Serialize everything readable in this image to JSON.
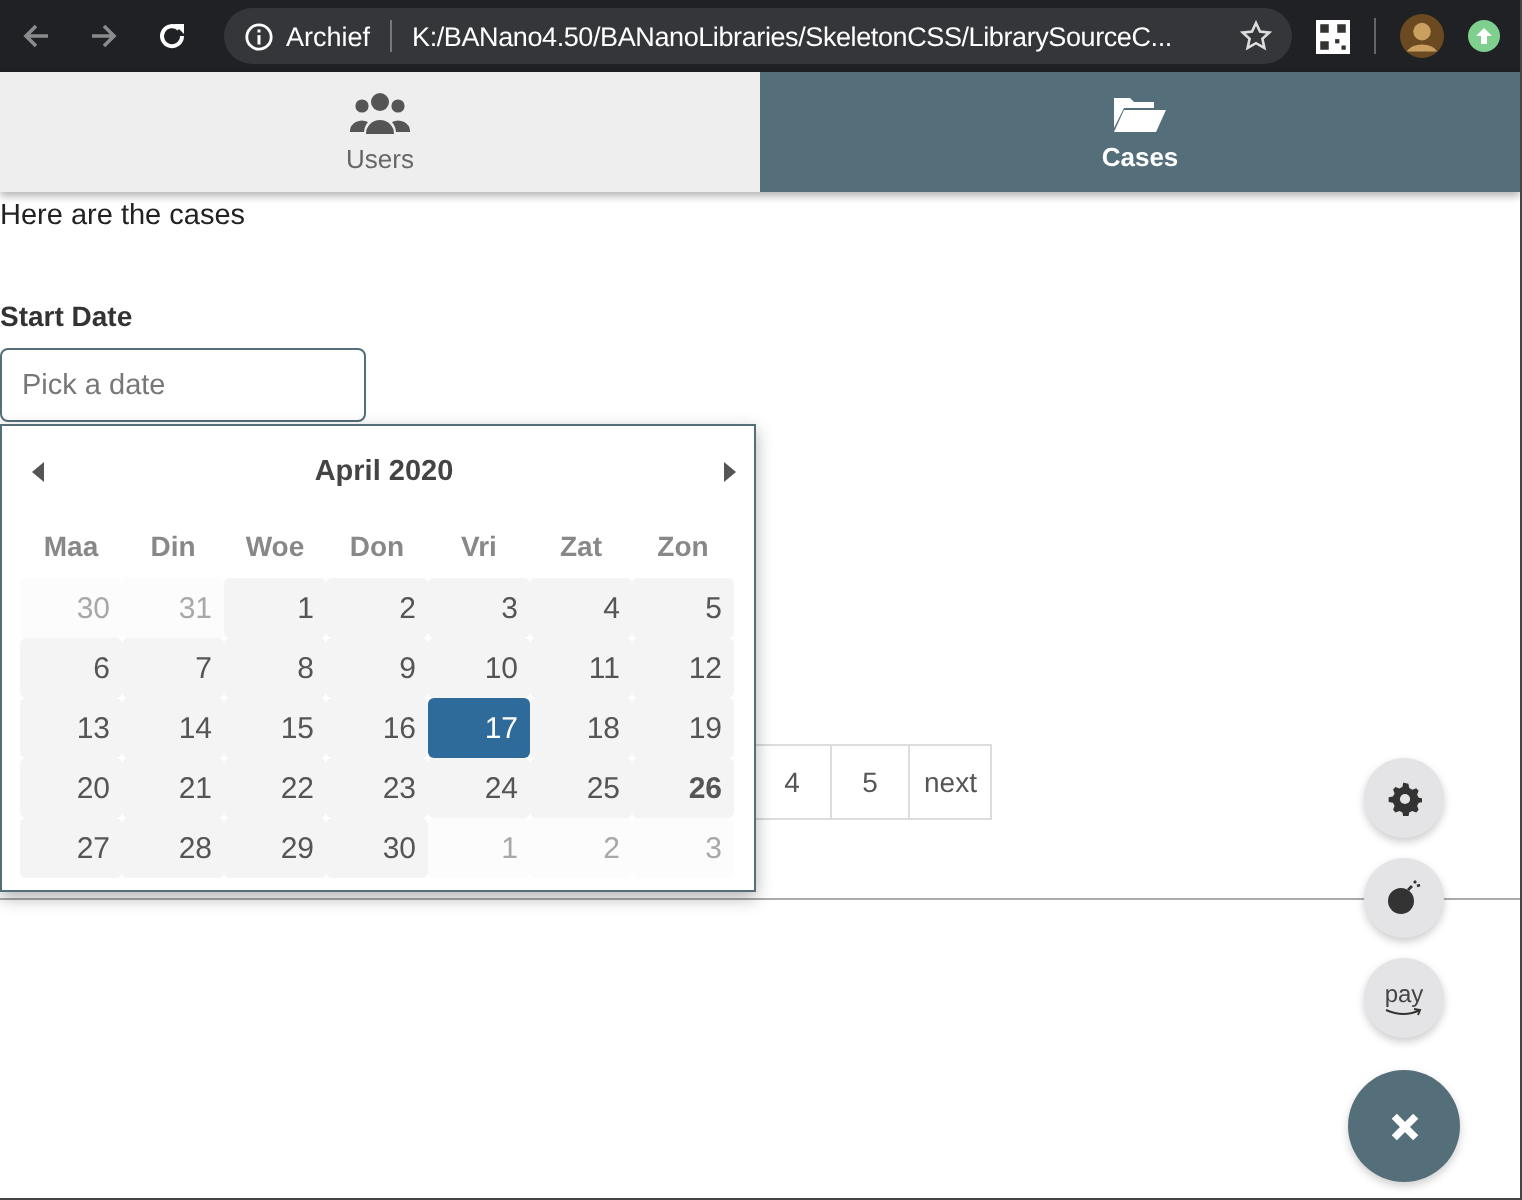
{
  "browser": {
    "site_label": "Archief",
    "url": "K:/BANano4.50/BANanoLibraries/SkeletonCSS/LibrarySourceC..."
  },
  "tabs": [
    {
      "label": "Users",
      "kind": "users",
      "selected": false
    },
    {
      "label": "Cases",
      "kind": "cases",
      "selected": true
    }
  ],
  "intro": "Here are the cases",
  "start_date": {
    "label": "Start Date",
    "placeholder": "Pick a date"
  },
  "calendar": {
    "month": "April",
    "year": "2020",
    "weekdays": [
      "Maa",
      "Din",
      "Woe",
      "Don",
      "Vri",
      "Zat",
      "Zon"
    ],
    "weeks": [
      [
        {
          "day": "30",
          "kind": "outside",
          "selected": false
        },
        {
          "day": "31",
          "kind": "outside",
          "selected": false
        },
        {
          "day": "1",
          "kind": "day",
          "selected": false
        },
        {
          "day": "2",
          "kind": "day",
          "selected": false
        },
        {
          "day": "3",
          "kind": "day",
          "selected": false
        },
        {
          "day": "4",
          "kind": "day",
          "selected": false
        },
        {
          "day": "5",
          "kind": "day",
          "selected": false
        }
      ],
      [
        {
          "day": "6",
          "kind": "day",
          "selected": false
        },
        {
          "day": "7",
          "kind": "day",
          "selected": false
        },
        {
          "day": "8",
          "kind": "day",
          "selected": false
        },
        {
          "day": "9",
          "kind": "day",
          "selected": false
        },
        {
          "day": "10",
          "kind": "day",
          "selected": false
        },
        {
          "day": "11",
          "kind": "day",
          "selected": false
        },
        {
          "day": "12",
          "kind": "day",
          "selected": false
        }
      ],
      [
        {
          "day": "13",
          "kind": "day",
          "selected": false
        },
        {
          "day": "14",
          "kind": "day",
          "selected": false
        },
        {
          "day": "15",
          "kind": "day",
          "selected": false
        },
        {
          "day": "16",
          "kind": "day",
          "selected": false
        },
        {
          "day": "17",
          "kind": "day",
          "selected": true
        },
        {
          "day": "18",
          "kind": "day",
          "selected": false
        },
        {
          "day": "19",
          "kind": "day",
          "selected": false
        }
      ],
      [
        {
          "day": "20",
          "kind": "day",
          "selected": false
        },
        {
          "day": "21",
          "kind": "day",
          "selected": false
        },
        {
          "day": "22",
          "kind": "day",
          "selected": false
        },
        {
          "day": "23",
          "kind": "day",
          "selected": false
        },
        {
          "day": "24",
          "kind": "day",
          "selected": false
        },
        {
          "day": "25",
          "kind": "day",
          "selected": false
        },
        {
          "day": "26",
          "kind": "today",
          "selected": false
        }
      ],
      [
        {
          "day": "27",
          "kind": "day",
          "selected": false
        },
        {
          "day": "28",
          "kind": "day",
          "selected": false
        },
        {
          "day": "29",
          "kind": "day",
          "selected": false
        },
        {
          "day": "30",
          "kind": "day",
          "selected": false
        },
        {
          "day": "1",
          "kind": "outside",
          "selected": false
        },
        {
          "day": "2",
          "kind": "outside",
          "selected": false
        },
        {
          "day": "3",
          "kind": "outside",
          "selected": false
        }
      ]
    ]
  },
  "pagination": [
    "4",
    "5",
    "next"
  ],
  "fab_actions": [
    {
      "kind": "settings"
    },
    {
      "kind": "bomb"
    },
    {
      "kind": "pay",
      "label": "pay"
    }
  ]
}
